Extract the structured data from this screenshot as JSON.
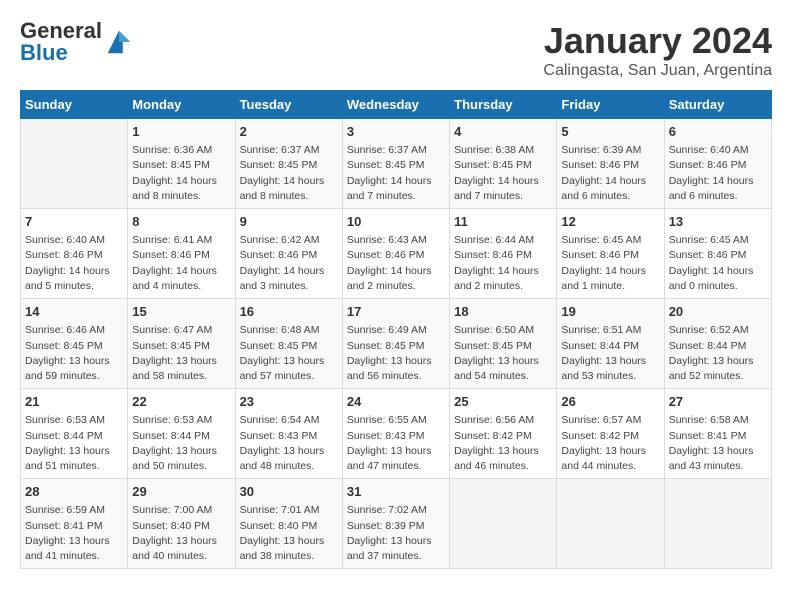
{
  "header": {
    "logo_general": "General",
    "logo_blue": "Blue",
    "title": "January 2024",
    "subtitle": "Calingasta, San Juan, Argentina"
  },
  "calendar": {
    "days_of_week": [
      "Sunday",
      "Monday",
      "Tuesday",
      "Wednesday",
      "Thursday",
      "Friday",
      "Saturday"
    ],
    "weeks": [
      [
        {
          "day": "",
          "content": ""
        },
        {
          "day": "1",
          "content": "Sunrise: 6:36 AM\nSunset: 8:45 PM\nDaylight: 14 hours\nand 8 minutes."
        },
        {
          "day": "2",
          "content": "Sunrise: 6:37 AM\nSunset: 8:45 PM\nDaylight: 14 hours\nand 8 minutes."
        },
        {
          "day": "3",
          "content": "Sunrise: 6:37 AM\nSunset: 8:45 PM\nDaylight: 14 hours\nand 7 minutes."
        },
        {
          "day": "4",
          "content": "Sunrise: 6:38 AM\nSunset: 8:45 PM\nDaylight: 14 hours\nand 7 minutes."
        },
        {
          "day": "5",
          "content": "Sunrise: 6:39 AM\nSunset: 8:46 PM\nDaylight: 14 hours\nand 6 minutes."
        },
        {
          "day": "6",
          "content": "Sunrise: 6:40 AM\nSunset: 8:46 PM\nDaylight: 14 hours\nand 6 minutes."
        }
      ],
      [
        {
          "day": "7",
          "content": "Sunrise: 6:40 AM\nSunset: 8:46 PM\nDaylight: 14 hours\nand 5 minutes."
        },
        {
          "day": "8",
          "content": "Sunrise: 6:41 AM\nSunset: 8:46 PM\nDaylight: 14 hours\nand 4 minutes."
        },
        {
          "day": "9",
          "content": "Sunrise: 6:42 AM\nSunset: 8:46 PM\nDaylight: 14 hours\nand 3 minutes."
        },
        {
          "day": "10",
          "content": "Sunrise: 6:43 AM\nSunset: 8:46 PM\nDaylight: 14 hours\nand 2 minutes."
        },
        {
          "day": "11",
          "content": "Sunrise: 6:44 AM\nSunset: 8:46 PM\nDaylight: 14 hours\nand 2 minutes."
        },
        {
          "day": "12",
          "content": "Sunrise: 6:45 AM\nSunset: 8:46 PM\nDaylight: 14 hours\nand 1 minute."
        },
        {
          "day": "13",
          "content": "Sunrise: 6:45 AM\nSunset: 8:46 PM\nDaylight: 14 hours\nand 0 minutes."
        }
      ],
      [
        {
          "day": "14",
          "content": "Sunrise: 6:46 AM\nSunset: 8:45 PM\nDaylight: 13 hours\nand 59 minutes."
        },
        {
          "day": "15",
          "content": "Sunrise: 6:47 AM\nSunset: 8:45 PM\nDaylight: 13 hours\nand 58 minutes."
        },
        {
          "day": "16",
          "content": "Sunrise: 6:48 AM\nSunset: 8:45 PM\nDaylight: 13 hours\nand 57 minutes."
        },
        {
          "day": "17",
          "content": "Sunrise: 6:49 AM\nSunset: 8:45 PM\nDaylight: 13 hours\nand 56 minutes."
        },
        {
          "day": "18",
          "content": "Sunrise: 6:50 AM\nSunset: 8:45 PM\nDaylight: 13 hours\nand 54 minutes."
        },
        {
          "day": "19",
          "content": "Sunrise: 6:51 AM\nSunset: 8:44 PM\nDaylight: 13 hours\nand 53 minutes."
        },
        {
          "day": "20",
          "content": "Sunrise: 6:52 AM\nSunset: 8:44 PM\nDaylight: 13 hours\nand 52 minutes."
        }
      ],
      [
        {
          "day": "21",
          "content": "Sunrise: 6:53 AM\nSunset: 8:44 PM\nDaylight: 13 hours\nand 51 minutes."
        },
        {
          "day": "22",
          "content": "Sunrise: 6:53 AM\nSunset: 8:44 PM\nDaylight: 13 hours\nand 50 minutes."
        },
        {
          "day": "23",
          "content": "Sunrise: 6:54 AM\nSunset: 8:43 PM\nDaylight: 13 hours\nand 48 minutes."
        },
        {
          "day": "24",
          "content": "Sunrise: 6:55 AM\nSunset: 8:43 PM\nDaylight: 13 hours\nand 47 minutes."
        },
        {
          "day": "25",
          "content": "Sunrise: 6:56 AM\nSunset: 8:42 PM\nDaylight: 13 hours\nand 46 minutes."
        },
        {
          "day": "26",
          "content": "Sunrise: 6:57 AM\nSunset: 8:42 PM\nDaylight: 13 hours\nand 44 minutes."
        },
        {
          "day": "27",
          "content": "Sunrise: 6:58 AM\nSunset: 8:41 PM\nDaylight: 13 hours\nand 43 minutes."
        }
      ],
      [
        {
          "day": "28",
          "content": "Sunrise: 6:59 AM\nSunset: 8:41 PM\nDaylight: 13 hours\nand 41 minutes."
        },
        {
          "day": "29",
          "content": "Sunrise: 7:00 AM\nSunset: 8:40 PM\nDaylight: 13 hours\nand 40 minutes."
        },
        {
          "day": "30",
          "content": "Sunrise: 7:01 AM\nSunset: 8:40 PM\nDaylight: 13 hours\nand 38 minutes."
        },
        {
          "day": "31",
          "content": "Sunrise: 7:02 AM\nSunset: 8:39 PM\nDaylight: 13 hours\nand 37 minutes."
        },
        {
          "day": "",
          "content": ""
        },
        {
          "day": "",
          "content": ""
        },
        {
          "day": "",
          "content": ""
        }
      ]
    ]
  }
}
